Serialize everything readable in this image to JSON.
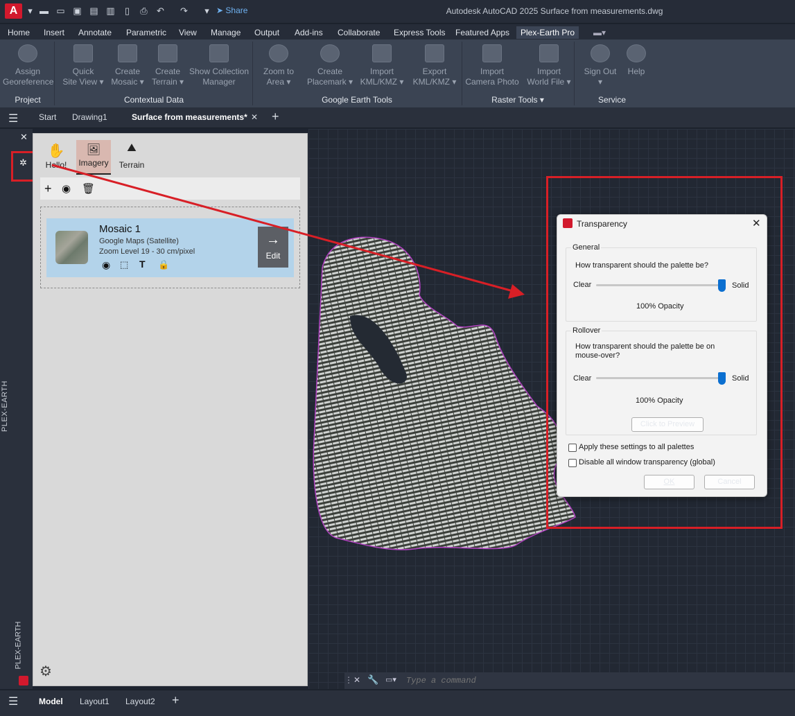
{
  "titlebar": {
    "logo": "A",
    "share": "Share",
    "title": "Autodesk AutoCAD 2025    Surface from measurements.dwg"
  },
  "menu": {
    "tabs": [
      "Home",
      "Insert",
      "Annotate",
      "Parametric",
      "View",
      "Manage",
      "Output",
      "Add-ins",
      "Collaborate",
      "Express Tools",
      "Featured Apps",
      "Plex-Earth Pro"
    ],
    "active": "Plex-Earth Pro"
  },
  "ribbon": {
    "buttons": [
      {
        "line1": "Assign",
        "line2": "Georeference"
      },
      {
        "line1": "Quick",
        "line2": "Site View"
      },
      {
        "line1": "Create",
        "line2": "Mosaic"
      },
      {
        "line1": "Create",
        "line2": "Terrain"
      },
      {
        "line1": "Show Collection",
        "line2": "Manager"
      },
      {
        "line1": "Zoom to",
        "line2": "Area"
      },
      {
        "line1": "Create",
        "line2": "Placemark"
      },
      {
        "line1": "Import",
        "line2": "KML/KMZ"
      },
      {
        "line1": "Export",
        "line2": "KML/KMZ"
      },
      {
        "line1": "Import",
        "line2": "Camera Photo"
      },
      {
        "line1": "Import",
        "line2": "World File"
      },
      {
        "line1": "Sign Out",
        "line2": ""
      },
      {
        "line1": "Help",
        "line2": ""
      }
    ],
    "panels": [
      "Project",
      "Contextual Data",
      "Google Earth Tools",
      "Raster Tools",
      "Service"
    ]
  },
  "doctabs": {
    "start": "Start",
    "drawing1": "Drawing1",
    "active": "Surface from measurements*"
  },
  "sidebar": {
    "vertical_label": "PLEX-EARTH",
    "vertical_label_bottom": "PLEX-EARTH"
  },
  "palette": {
    "tabs": [
      "Hello!",
      "Imagery",
      "Terrain"
    ],
    "active_tab": "Imagery",
    "card": {
      "title": "Mosaic 1",
      "source": "Google Maps (Satellite)",
      "zoom": "Zoom Level 19 - 30 cm/pixel",
      "edit": "Edit"
    }
  },
  "command": {
    "placeholder": "Type a command"
  },
  "layouts": {
    "tabs": [
      "Model",
      "Layout1",
      "Layout2"
    ],
    "active": "Model"
  },
  "dialog": {
    "title": "Transparency",
    "general": {
      "label": "General",
      "question": "How transparent should the palette be?",
      "clear": "Clear",
      "solid": "Solid",
      "opacity": "100% Opacity",
      "value": 1.0
    },
    "rollover": {
      "label": "Rollover",
      "question_line1": "How transparent should the palette be on",
      "question_line2": "mouse-over?",
      "clear": "Clear",
      "solid": "Solid",
      "opacity": "100% Opacity",
      "value": 1.0,
      "preview": "Click to Preview"
    },
    "apply_all": "Apply these settings to all palettes",
    "disable_global": "Disable all window transparency (global)",
    "ok": "OK",
    "cancel": "Cancel"
  },
  "colors": {
    "highlight": "#d81f26",
    "card": "#b3d3ea",
    "accent": "#0b6fd0"
  }
}
